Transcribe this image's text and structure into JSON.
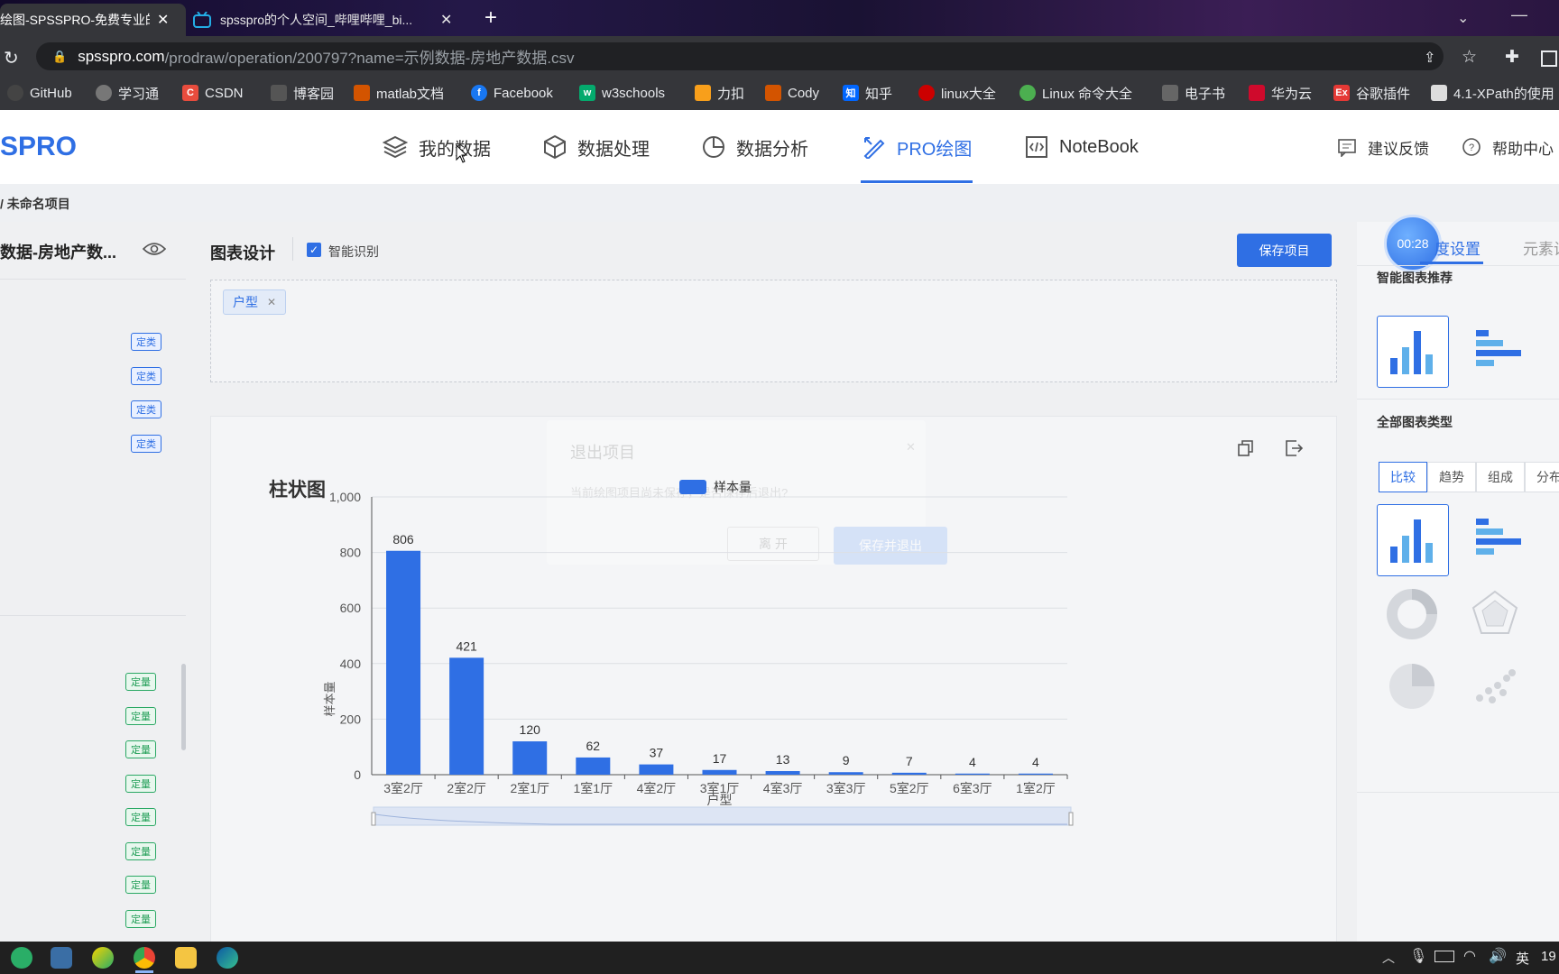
{
  "browser": {
    "tabs": [
      {
        "title": "绘图-SPSSPRO-免费专业的..."
      },
      {
        "title": "spsspro的个人空间_哔哩哔哩_bi..."
      }
    ],
    "url_host": "spsspro.com",
    "url_path": "/prodraw/operation/200797?name=示例数据-房地产数据.csv",
    "bookmarks": [
      "GitHub",
      "学习通",
      "CSDN",
      "博客园",
      "matlab文档",
      "Facebook",
      "w3schools",
      "力扣",
      "Cody",
      "知乎",
      "linux大全",
      "Linux 命令大全",
      "电子书",
      "华为云",
      "谷歌插件",
      "4.1-XPath的使用"
    ]
  },
  "app": {
    "logo": "SPRO",
    "nav": [
      "我的数据",
      "数据处理",
      "数据分析",
      "PRO绘图",
      "NoteBook"
    ],
    "right_links": [
      "建议反馈",
      "帮助中心"
    ],
    "breadcrumb": "/ 未命名项目"
  },
  "left": {
    "dataset": "数据-房地产数...",
    "categorical_tag": "定类",
    "numeric_tag": "定量"
  },
  "center": {
    "title": "图表设计",
    "smart_label": "智能识别",
    "save_button": "保存项目",
    "field_chip": "户型"
  },
  "dialog": {
    "title": "退出项目",
    "message": "当前绘图项目尚未保存，是否保存后退出?",
    "cancel": "离 开",
    "confirm": "保存并退出"
  },
  "right": {
    "timer": "00:28",
    "tab_active": "度设置",
    "tab_other": "元素设",
    "recommend_title": "智能图表推荐",
    "all_types_title": "全部图表类型",
    "type_tabs": [
      "比较",
      "趋势",
      "组成",
      "分布"
    ]
  },
  "chart_data": {
    "type": "bar",
    "title": "柱状图",
    "legend": "样本量",
    "xlabel": "户型",
    "ylabel": "样本量",
    "categories": [
      "3室2厅",
      "2室2厅",
      "2室1厅",
      "1室1厅",
      "4室2厅",
      "3室1厅",
      "4室3厅",
      "3室3厅",
      "5室2厅",
      "6室3厅",
      "1室2厅"
    ],
    "values": [
      806,
      421,
      120,
      62,
      37,
      17,
      13,
      9,
      7,
      4,
      4
    ],
    "ylim": [
      0,
      1000
    ],
    "yticks": [
      "0",
      "200",
      "400",
      "600",
      "800",
      "1,000"
    ],
    "grid": true,
    "colors": {
      "bar": "#2f6fe4",
      "accent": "#2f6fe4"
    }
  },
  "taskbar": {
    "ime": "英",
    "clock": "19"
  }
}
